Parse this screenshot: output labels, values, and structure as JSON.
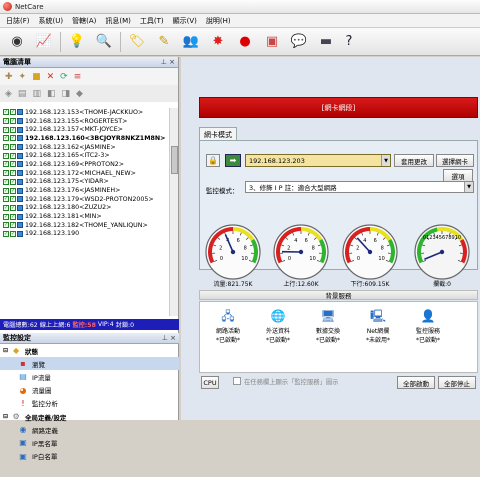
{
  "app": {
    "title": "NetCare"
  },
  "menu": [
    "日誌(F)",
    "系統(U)",
    "管轄(A)",
    "訊息(M)",
    "工具(T)",
    "顯示(V)",
    "說明(H)"
  ],
  "left": {
    "computer_list_title": "電腦清單",
    "computers": [
      "192.168.123.153<THOME-JACKKUO>",
      "192.168.123.155<ROGERTEST>",
      "192.168.123.157<MKT-JOYCE>",
      "192.168.123.160<3BCJOYR8NKZ1M8N>",
      "192.168.123.162<JASMINE>",
      "192.168.123.165<ITC2-3>",
      "192.168.123.169<PPROTON2>",
      "192.168.123.172<MICHAEL_NEW>",
      "192.168.123.175<YIDAR>",
      "192.168.123.176<JASMINEH>",
      "192.168.123.179<WSD2-PROTON2005>",
      "192.168.123.180<ZUZU2>",
      "192.168.123.181<MIN>",
      "192.168.123.182<THOME_YANLIQUN>",
      "192.168.123.190"
    ],
    "status": {
      "total": "電腦總數:62",
      "online": "線上上網:6",
      "monitor": "監控:58",
      "vip": "VIP:4",
      "locked": "封鎖:0"
    },
    "monitor_title": "監控設定",
    "monitor_items": [
      "狀態",
      "瀏覽",
      "IP流量",
      "流量圖",
      "監控分析",
      "全局定義/設定",
      "網路定義",
      "IP黑名單",
      "IP白名單"
    ]
  },
  "main": {
    "red_bar_text": "[網卡網段]",
    "nic_tab": "網卡模式",
    "ip_value": "192.168.123.203",
    "btn_apply": "套用更改",
    "btn_select_nic": "選擇網卡",
    "btn_advanced": "選項",
    "mode_label": "監控模式：",
    "mode_value": "3、修飾 I P          註：適合大型網路",
    "gauges": [
      {
        "label": "流量:821.75K",
        "fraction": 0.4
      },
      {
        "label": "上行:12.60K",
        "fraction": 0.12
      },
      {
        "label": "下行:609.15K",
        "fraction": 0.32
      },
      {
        "label": "攔截:0",
        "fraction": 0.02
      }
    ],
    "gauge_ticks": "0 2 4 6 8 10",
    "gauge4_ticks": "012345678910",
    "services_title": "背景服務",
    "services": [
      {
        "name": "網路活動",
        "state": "*已啟動*"
      },
      {
        "name": "外送資料",
        "state": "*已啟動*"
      },
      {
        "name": "數據交換",
        "state": "*已啟動*"
      },
      {
        "name": "Net網攔",
        "state": "*未啟用*"
      },
      {
        "name": "監控服務",
        "state": "*已啟動*"
      }
    ],
    "cpu_button": "CPU",
    "tray_checkbox_label": "在任務欄上顯示「監控服務」圖示",
    "btn_start_all": "全部啟動",
    "btn_stop_all": "全部停止"
  }
}
